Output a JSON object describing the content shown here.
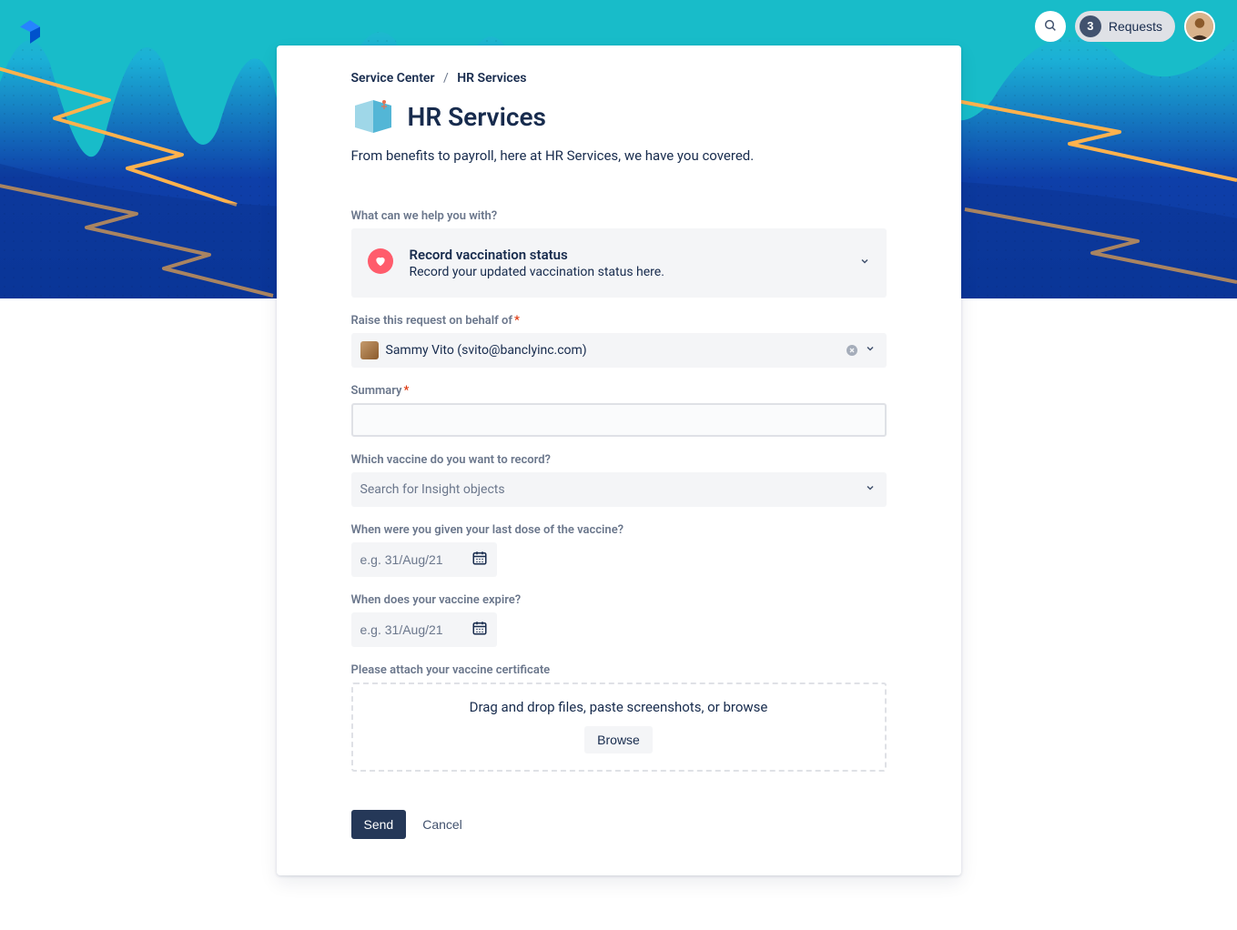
{
  "topbar": {
    "requests_count": "3",
    "requests_label": "Requests"
  },
  "breadcrumb": {
    "root": "Service Center",
    "current": "HR Services"
  },
  "page": {
    "title": "HR Services",
    "subtitle": "From benefits to payroll, here at HR Services, we have you covered."
  },
  "form": {
    "help_with_label": "What can we help you with?",
    "request_type": {
      "title": "Record vaccination status",
      "desc": "Record your updated vaccination status here."
    },
    "on_behalf_label": "Raise this request on behalf of",
    "on_behalf_value": "Sammy Vito (svito@banclyinc.com)",
    "summary_label": "Summary",
    "summary_value": "",
    "vaccine_label": "Which vaccine do you want to record?",
    "vaccine_placeholder": "Search for Insight objects",
    "last_dose_label": "When were you given your last dose of the vaccine?",
    "date_placeholder": "e.g. 31/Aug/21",
    "expires_label": "When does your vaccine expire?",
    "attach_label": "Please attach your vaccine certificate",
    "dropzone_text": "Drag and drop files, paste screenshots, or browse",
    "browse_label": "Browse"
  },
  "actions": {
    "send": "Send",
    "cancel": "Cancel"
  }
}
